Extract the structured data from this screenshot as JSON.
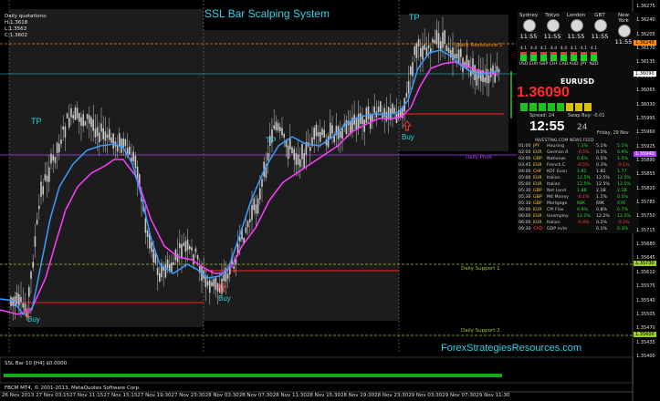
{
  "title": "SSL Bar Scalping System",
  "watermark": "ForexStrategiesResources.com",
  "daily_quotations": {
    "label": "Daily quotations:",
    "high": "H:1.3618",
    "low": "L:1.3563",
    "close": "C:1.3602"
  },
  "levels": {
    "resistance_1": "Daily Resistance 1",
    "pivot": "Daily Pivot",
    "support_1": "Daily Support 1",
    "support_2": "Daily Support 2"
  },
  "markers": {
    "tp": "TP",
    "buy": "Buy"
  },
  "y_axis": [
    "1.36275",
    "1.36240",
    "1.36205",
    "1.36170",
    "1.36135",
    "1.36100",
    "1.36065",
    "1.36030",
    "1.35995",
    "1.35960",
    "1.35925",
    "1.35890",
    "1.35855",
    "1.35820",
    "1.35785",
    "1.35750",
    "1.35715",
    "1.35680",
    "1.35645",
    "1.35610",
    "1.35575",
    "1.35540",
    "1.35505",
    "1.35470",
    "1.35435",
    "1.35400"
  ],
  "price_labels": {
    "resistance_1": "1.36240",
    "current": "1.36090",
    "pivot": "1.35940",
    "support_1": "1.35730",
    "support_2": "1.35600"
  },
  "x_axis": [
    "26 Nov 2013",
    "27 Nov 03:15",
    "27 Nov 11:15",
    "27 Nov 15:15",
    "27 Nov 19:30",
    "27 Nov 23:30",
    "28 Nov 03:30",
    "28 Nov 07:30",
    "28 Nov 11:30",
    "28 Nov 15:30",
    "28 Nov 19:30",
    "28 Nov 23:30",
    "29 Nov 03:30",
    "29 Nov 07:30",
    "29 Nov 11:30"
  ],
  "indicator_label": "SSL Bar 10 [H4] $0.0000",
  "footer": "FBCM MT4, © 2001-2013, MetaQuotes Software Corp.",
  "widget": {
    "cities": [
      {
        "name": "Sydney",
        "time": "11:55"
      },
      {
        "name": "Tokyo",
        "time": "11:55"
      },
      {
        "name": "London",
        "time": "11:55"
      },
      {
        "name": "GBT",
        "time": "11:55"
      },
      {
        "name": "New York",
        "time": "11:55"
      }
    ],
    "currencies": [
      "USD",
      "EUR",
      "GBP",
      "CHF",
      "CAD",
      "AUD",
      "JPY",
      "NZD"
    ],
    "strengths": [
      "4.1",
      "4.4",
      "4.1",
      "4.4",
      "4.4",
      "4.1",
      "4.1",
      "4.1"
    ],
    "pair": "EURUSD",
    "price": "1.36090",
    "spread": "Spread: 24",
    "swap": "Swap Buy: -0.01",
    "time": "12:55",
    "day": "24",
    "date_text": "Friday, 29 Nov",
    "news_header": "INVESTING.COM NEWS FEED",
    "news": [
      {
        "time": "01:00",
        "cur": "JPY",
        "event": "Housing",
        "a": "7.1%",
        "b": "5.1%",
        "c": "5.1%"
      },
      {
        "time": "02:00",
        "cur": "EUR",
        "event": "German R",
        "a": "-0.5%",
        "b": "0.5%",
        "c": "0.9%"
      },
      {
        "time": "03:00",
        "cur": "GBP",
        "event": "Nationwi",
        "a": "0.6%",
        "b": "0.5%",
        "c": "1.0%"
      },
      {
        "time": "03:45",
        "cur": "EUR",
        "event": "French C",
        "a": "-0.5%",
        "b": "0.3%",
        "c": "-0.1%"
      },
      {
        "time": "04:00",
        "cur": "CHF",
        "event": "KOF Econ",
        "a": "1.81",
        "b": "1.82",
        "c": "1.77"
      },
      {
        "time": "05:00",
        "cur": "EUR",
        "event": "Italian",
        "a": "12.5%",
        "b": "12.5%",
        "c": "12.5%"
      },
      {
        "time": "05:00",
        "cur": "EUR",
        "event": "Italian",
        "a": "12.5%",
        "b": "12.5%",
        "c": "12.5%"
      },
      {
        "time": "05:30",
        "cur": "GBP",
        "event": "Net Lend",
        "a": "1.8B",
        "b": "2.1B",
        "c": "2.3B"
      },
      {
        "time": "05:30",
        "cur": "GBP",
        "event": "M4 Money",
        "a": "-0.1%",
        "b": "1.1%",
        "c": "0.5%"
      },
      {
        "time": "05:30",
        "cur": "GBP",
        "event": "Mortgage",
        "a": "68K",
        "b": "69K",
        "c": "67K"
      },
      {
        "time": "06:00",
        "cur": "EUR",
        "event": "CPI Flas",
        "a": "0.9%",
        "b": "0.8%",
        "c": "0.7%"
      },
      {
        "time": "06:00",
        "cur": "EUR",
        "event": "Unemploy",
        "a": "12.1%",
        "b": "12.2%",
        "c": "12.2%"
      },
      {
        "time": "06:00",
        "cur": "EUR",
        "event": "Italian",
        "a": "-0.4%",
        "b": "0.2%",
        "c": "-0.2%"
      },
      {
        "time": "09:30",
        "cur": "CAD",
        "event": "GDP m/m",
        "a": "",
        "b": "0.1%",
        "c": "0.3%"
      }
    ]
  },
  "colors": {
    "background": "#000000",
    "session_box": "#1c1c1c",
    "candle": "#c8c8c8",
    "ssl_fast": "#3a9cff",
    "ssl_slow": "#ff3dff",
    "resistance": "#ff8c1a",
    "pivot": "#b040ff",
    "support": "#9acd32",
    "red_line": "#ff2020",
    "cyan_line": "#2fd3e6",
    "accent_text": "#2fd3e6",
    "green_bar": "#1aa81a"
  }
}
